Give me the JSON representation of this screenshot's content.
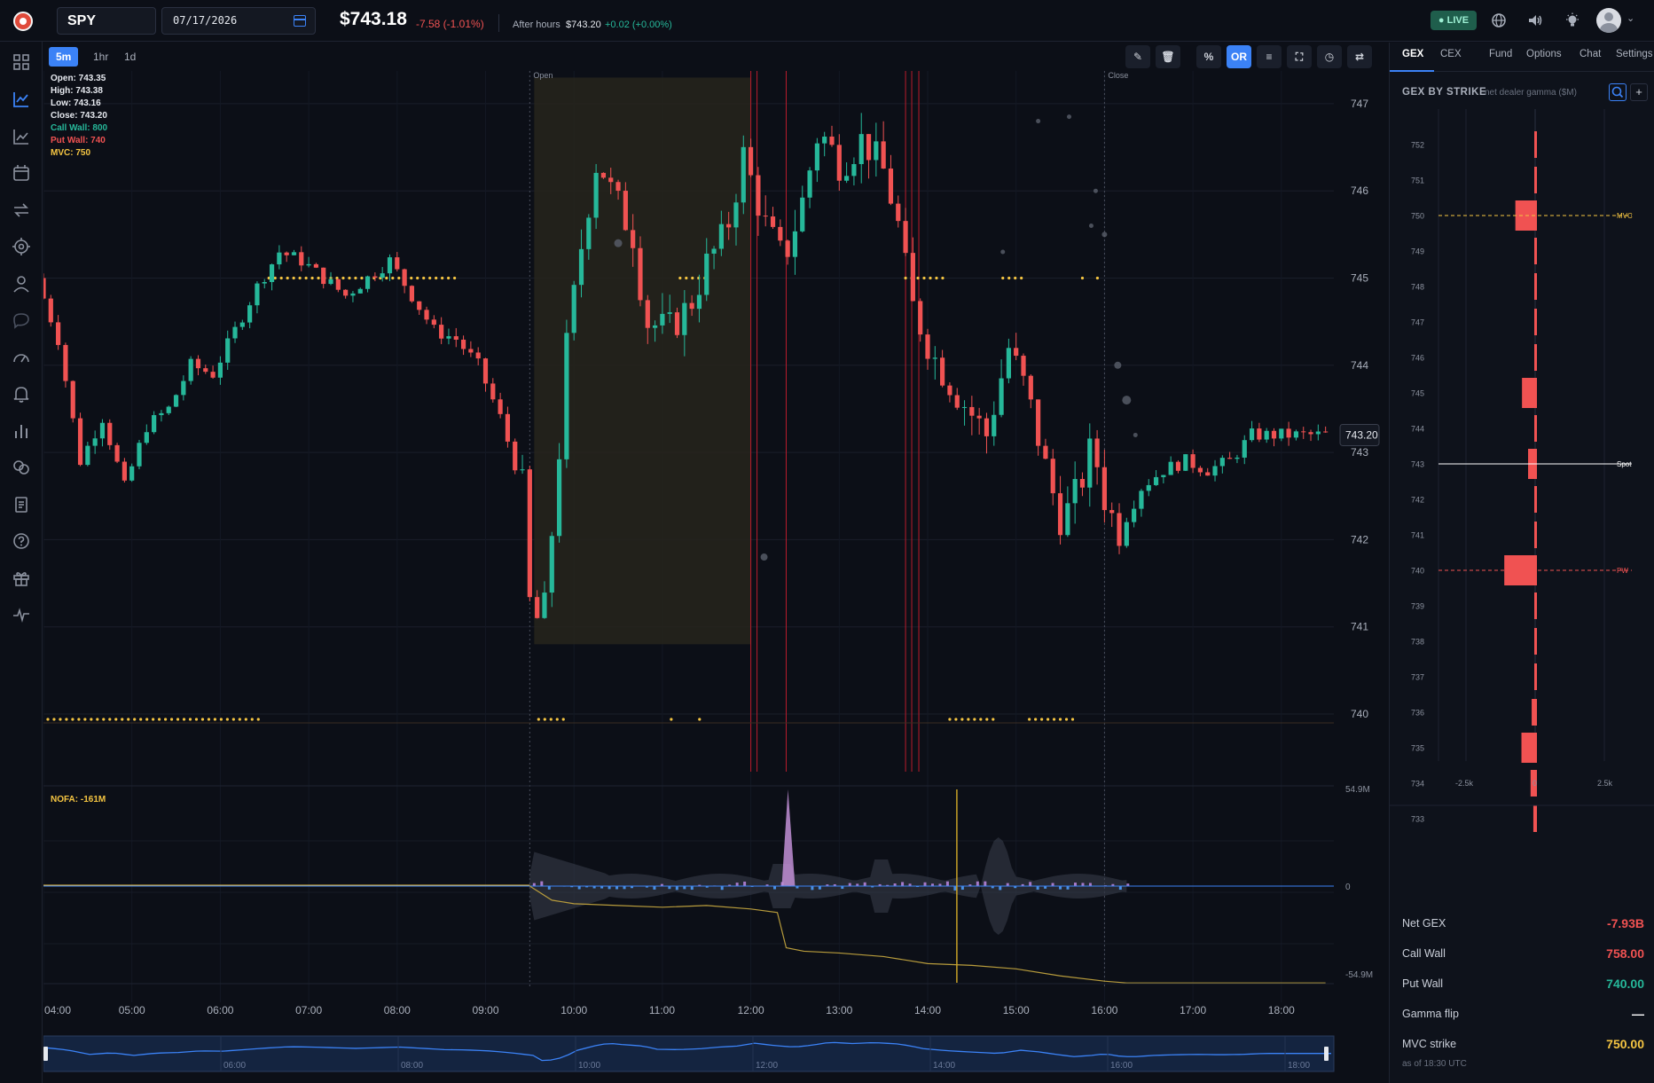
{
  "header": {
    "ticker": "SPY",
    "date": "07/17/2026",
    "price": "$743.18",
    "change": "-7.58 (-1.01%)",
    "after_hours_label": "After hours",
    "after_hours_price": "$743.20",
    "after_hours_change": "+0.02 (+0.00%)",
    "live_badge": "● LIVE",
    "icons": [
      "globe-icon",
      "speaker-icon",
      "lightbulb-icon",
      "avatar-icon",
      "chevron-down-icon"
    ]
  },
  "sidebar": {
    "icons": [
      "grid-icon",
      "line-chart-icon",
      "trend-chart-icon",
      "calendar-icon",
      "swap-icon",
      "target-icon",
      "user-icon",
      "chat-icon",
      "gauge-icon",
      "bell-icon",
      "bar-chart-icon",
      "coins-icon",
      "document-icon",
      "help-icon",
      "gift-icon",
      "pulse-icon"
    ]
  },
  "toolbar": {
    "timeframes": [
      "5m",
      "1hr",
      "1d"
    ],
    "active_timeframe": "5m",
    "buttons": [
      {
        "name": "pencil-icon",
        "label": "✎"
      },
      {
        "name": "trash-icon",
        "label": "🗑"
      },
      {
        "name": "percent-button",
        "label": "%"
      },
      {
        "name": "or-button",
        "label": "OR"
      },
      {
        "name": "menu-icon",
        "label": "≡"
      },
      {
        "name": "expand-icon",
        "label": "⛶"
      },
      {
        "name": "clock-icon",
        "label": "◷"
      },
      {
        "name": "swap-icon",
        "label": "⇄"
      }
    ]
  },
  "ohlc": {
    "open": "Open: 743.35",
    "high": "High: 743.38",
    "low": "Low: 743.16",
    "close": "Close: 743.20",
    "call_wall": "Call Wall: 800",
    "put_wall": "Put Wall: 740",
    "mvc": "MVC: 750"
  },
  "chart_data": [
    {
      "type": "candlestick",
      "x_ticks": [
        "04:00",
        "05:00",
        "06:00",
        "07:00",
        "08:00",
        "09:00",
        "10:00",
        "11:00",
        "12:00",
        "13:00",
        "14:00",
        "15:00",
        "16:00",
        "17:00",
        "18:00"
      ],
      "y_ticks": [
        740,
        741,
        742,
        743,
        744,
        745,
        746,
        747
      ],
      "ylim": [
        740,
        747.9
      ],
      "session_labels": [
        "Open",
        "Close"
      ],
      "last_price_label": "743.20",
      "last_price": 743.2,
      "levels": [
        {
          "name": "Put Wall",
          "value": 740,
          "color": "#f05252"
        },
        {
          "name": "MVC",
          "value": 750,
          "color": "#f5c542"
        },
        {
          "name": "Call Wall",
          "value": 800,
          "color": "#26b89a"
        }
      ],
      "closes": [
        [
          4.0,
          745.0
        ],
        [
          4.25,
          744.3
        ],
        [
          4.5,
          742.9
        ],
        [
          4.75,
          743.4
        ],
        [
          5.0,
          742.6
        ],
        [
          5.25,
          743.3
        ],
        [
          5.5,
          743.5
        ],
        [
          5.75,
          744.0
        ],
        [
          6.0,
          743.9
        ],
        [
          6.25,
          744.4
        ],
        [
          6.5,
          744.9
        ],
        [
          6.75,
          745.3
        ],
        [
          7.0,
          745.2
        ],
        [
          7.25,
          745.0
        ],
        [
          7.5,
          744.8
        ],
        [
          7.75,
          745.0
        ],
        [
          8.0,
          745.2
        ],
        [
          8.25,
          744.8
        ],
        [
          8.5,
          744.4
        ],
        [
          8.75,
          744.3
        ],
        [
          9.0,
          744.0
        ],
        [
          9.25,
          743.4
        ],
        [
          9.5,
          742.6
        ],
        [
          9.6,
          741.0
        ],
        [
          9.75,
          741.2
        ],
        [
          9.9,
          742.8
        ],
        [
          10.0,
          744.2
        ],
        [
          10.2,
          745.6
        ],
        [
          10.35,
          746.4
        ],
        [
          10.5,
          746.0
        ],
        [
          10.75,
          745.5
        ],
        [
          10.9,
          744.5
        ],
        [
          11.15,
          744.4
        ],
        [
          11.4,
          744.7
        ],
        [
          11.6,
          745.2
        ],
        [
          11.8,
          745.5
        ],
        [
          12.0,
          746.4
        ],
        [
          12.25,
          745.6
        ],
        [
          12.45,
          745.2
        ],
        [
          12.65,
          745.8
        ],
        [
          12.85,
          746.7
        ],
        [
          13.1,
          746.3
        ],
        [
          13.35,
          746.6
        ],
        [
          13.6,
          746.2
        ],
        [
          13.75,
          745.6
        ],
        [
          13.9,
          744.7
        ],
        [
          14.15,
          744.1
        ],
        [
          14.4,
          743.7
        ],
        [
          14.75,
          743.2
        ],
        [
          15.0,
          744.2
        ],
        [
          15.2,
          743.7
        ],
        [
          15.45,
          742.7
        ],
        [
          15.6,
          742.2
        ],
        [
          15.8,
          742.6
        ],
        [
          15.95,
          743.1
        ],
        [
          16.1,
          742.4
        ],
        [
          16.25,
          742.1
        ],
        [
          16.5,
          742.6
        ],
        [
          16.75,
          742.8
        ],
        [
          17.0,
          742.9
        ],
        [
          17.25,
          742.8
        ],
        [
          17.5,
          742.9
        ],
        [
          17.75,
          743.2
        ],
        [
          18.0,
          743.2
        ],
        [
          18.25,
          743.2
        ],
        [
          18.5,
          743.2
        ]
      ]
    },
    {
      "type": "area",
      "name": "NOFA",
      "label": "NOFA: -161M",
      "y_ticks": [
        "54.9M",
        "0",
        "-54.9M"
      ],
      "ylim": [
        -54.9,
        54.9
      ],
      "x": [
        9.5,
        9.75,
        10.0,
        10.5,
        11.0,
        11.5,
        12.0,
        12.3,
        12.4,
        12.6,
        13.0,
        13.5,
        14.0,
        14.5,
        15.0,
        15.5,
        16.0,
        16.25,
        17.0,
        18.5
      ],
      "values": [
        0,
        -8,
        -10,
        -11,
        -12,
        -11,
        -13,
        -15,
        -35,
        -37,
        -38,
        -40,
        -44,
        -45,
        -47,
        -51,
        -54,
        -55,
        -55,
        -55
      ]
    },
    {
      "type": "bar",
      "name": "GEX by Strike",
      "title": "GEX BY STRIKE",
      "subtitle": "net dealer gamma ($M)",
      "orientation": "horizontal",
      "categories": [
        752,
        751,
        750,
        749,
        748,
        747,
        746,
        745,
        744,
        743,
        742,
        741,
        740,
        739,
        738,
        737,
        736,
        735,
        734,
        733
      ],
      "values": [
        -20,
        -60,
        -780,
        -60,
        -70,
        -60,
        -70,
        -540,
        -30,
        -320,
        -30,
        -40,
        -1180,
        -40,
        -80,
        -50,
        -190,
        -560,
        -230,
        -130
      ],
      "x_ticks": [
        "-2.5k",
        "0",
        "2.5k"
      ],
      "xlim": [
        -3600,
        2600
      ],
      "markers": [
        {
          "label": "MVC",
          "strike": 750,
          "color": "#f5c542"
        },
        {
          "label": "Spot",
          "strike": 743,
          "color": "#ffffff"
        },
        {
          "label": "PW",
          "strike": 740,
          "color": "#f05252"
        }
      ]
    }
  ],
  "minimap": {
    "ticks": [
      "06:00",
      "08:00",
      "10:00",
      "12:00",
      "14:00",
      "16:00",
      "18:00"
    ]
  },
  "panel": {
    "tabs": [
      "GEX",
      "CEX",
      "Fund",
      "Options",
      "Chat",
      "Settings"
    ],
    "active_tab": "GEX",
    "stats": [
      {
        "label": "Net GEX",
        "value": "-7.93B",
        "color": "#f05252"
      },
      {
        "label": "Call Wall",
        "value": "758.00",
        "color": "#f05252"
      },
      {
        "label": "Put Wall",
        "value": "740.00",
        "color": "#26b89a"
      },
      {
        "label": "Gamma flip",
        "value": "—",
        "color": "#ffffff"
      },
      {
        "label": "MVC strike",
        "value": "750.00",
        "color": "#f5c542"
      }
    ],
    "as_of": "as of 18:30 UTC"
  },
  "colors": {
    "up": "#26b89a",
    "down": "#f05252",
    "accent": "#3b82f6",
    "gold": "#f5c542"
  }
}
